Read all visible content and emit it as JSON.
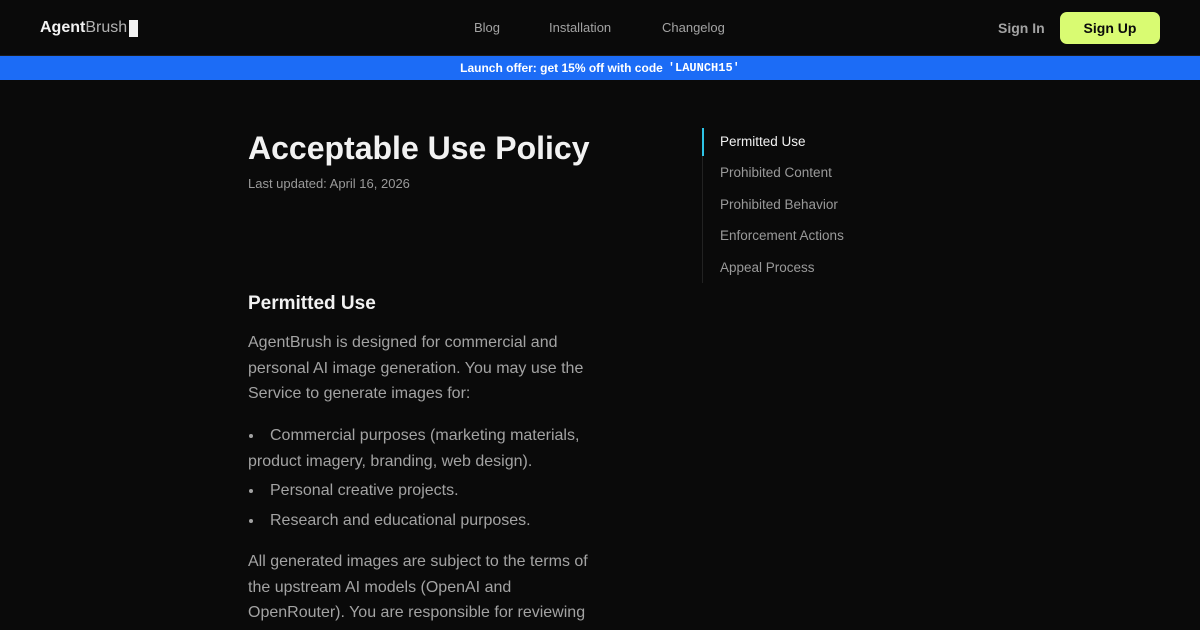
{
  "header": {
    "logo_bold": "Agent",
    "logo_light": "Brush",
    "nav": {
      "blog": "Blog",
      "installation": "Installation",
      "changelog": "Changelog"
    },
    "sign_in": "Sign In",
    "sign_up": "Sign Up"
  },
  "banner": {
    "text": "Launch offer: get 15% off with code",
    "code": "'LAUNCH15'"
  },
  "page": {
    "title": "Acceptable Use Policy",
    "last_updated": "Last updated: April 16, 2026",
    "section_title": "Permitted Use",
    "intro": "AgentBrush is designed for commercial and personal AI image generation. You may use the Service to generate images for:",
    "bullets": [
      "Commercial purposes (marketing materials, product imagery, branding, web design).",
      "Personal creative projects.",
      "Research and educational purposes."
    ],
    "paragraph2": "All generated images are subject to the terms of the upstream AI models (OpenAI and OpenRouter). You are responsible for reviewing"
  },
  "toc": {
    "items": [
      "Permitted Use",
      "Prohibited Content",
      "Prohibited Behavior",
      "Enforcement Actions",
      "Appeal Process"
    ],
    "active_index": 0
  },
  "colors": {
    "background": "#0a0a0a",
    "accent_button": "#d9fb72",
    "banner": "#1c6cf6",
    "toc_indicator": "#2ec4e6"
  }
}
